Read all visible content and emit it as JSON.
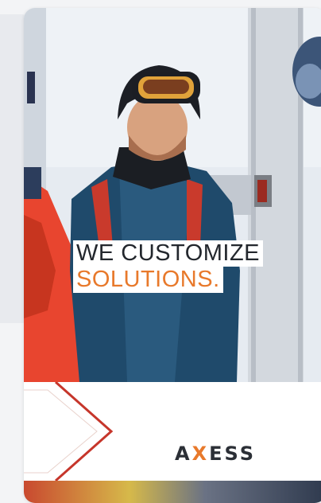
{
  "ad": {
    "headline_line1": "WE CUSTOMIZE",
    "headline_line2": "SOLUTIONS.",
    "accent_color": "#e8792b",
    "text_color": "#23272d"
  },
  "brand": {
    "logo_text": "AXESS",
    "logo_a": "A",
    "logo_x": "X",
    "logo_rest": "ESS"
  }
}
